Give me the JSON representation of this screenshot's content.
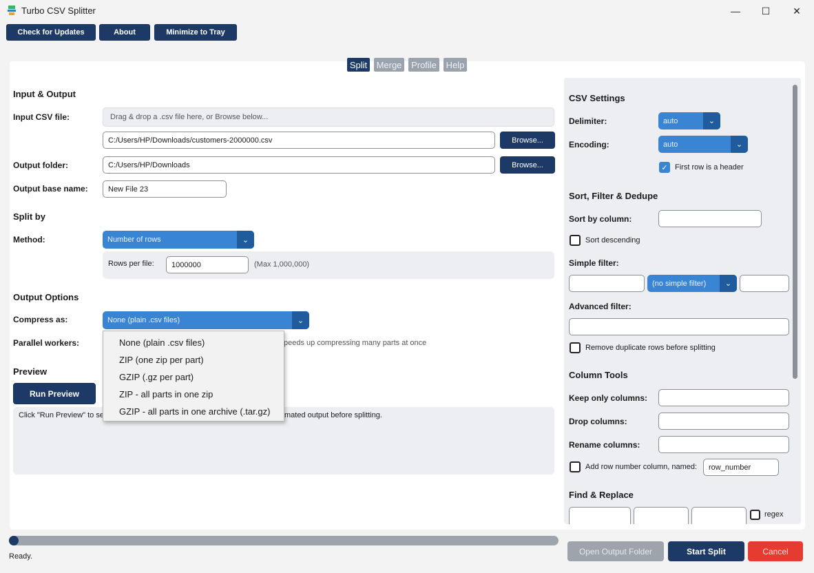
{
  "window": {
    "title": "Turbo CSV Splitter",
    "minimize_glyph": "—",
    "maximize_glyph": "☐",
    "close_glyph": "✕"
  },
  "toolbar": {
    "check_updates": "Check for Updates",
    "about": "About",
    "minimize_tray": "Minimize to Tray"
  },
  "tabs": [
    {
      "label": "Split",
      "active": true
    },
    {
      "label": "Merge",
      "active": false
    },
    {
      "label": "Profile",
      "active": false
    },
    {
      "label": "Help",
      "active": false
    }
  ],
  "input_output": {
    "section": "Input & Output",
    "input_label": "Input CSV file:",
    "dropzone_text": "Drag & drop a .csv file here, or Browse below...",
    "input_path": "C:/Users/HP/Downloads/customers-2000000.csv",
    "browse": "Browse...",
    "output_label": "Output folder:",
    "output_path": "C:/Users/HP/Downloads",
    "basename_label": "Output base name:",
    "basename_value": "New File 23"
  },
  "split_by": {
    "section": "Split by",
    "method_label": "Method:",
    "method_value": "Number of rows",
    "rows_label": "Rows per file:",
    "rows_value": "1000000",
    "rows_hint": "(Max 1,000,000)"
  },
  "output_options": {
    "section": "Output Options",
    "compress_label": "Compress as:",
    "compress_value": "None (plain .csv files)",
    "workers_label": "Parallel workers:",
    "workers_hint": "peeds up compressing many parts at once",
    "compress_options": [
      "None (plain .csv files)",
      "ZIP (one zip per part)",
      "GZIP (.gz per part)",
      "ZIP - all parts in one zip",
      "GZIP - all parts in one archive (.tar.gz)"
    ]
  },
  "preview": {
    "section": "Preview",
    "run_button": "Run Preview",
    "text_left": "Click \"Run Preview\" to se",
    "text_right": "mated output before splitting."
  },
  "csv_settings": {
    "section": "CSV Settings",
    "delimiter_label": "Delimiter:",
    "delimiter_value": "auto",
    "encoding_label": "Encoding:",
    "encoding_value": "auto",
    "header_label": "First row is a header",
    "header_checked": true
  },
  "sort_filter": {
    "section": "Sort, Filter & Dedupe",
    "sort_label": "Sort by column:",
    "sort_desc_label": "Sort descending",
    "simple_filter_label": "Simple filter:",
    "simple_filter_op": "(no simple filter)",
    "advanced_filter_label": "Advanced filter:",
    "dedupe_label": "Remove duplicate rows before splitting"
  },
  "column_tools": {
    "section": "Column Tools",
    "keep_label": "Keep only columns:",
    "drop_label": "Drop columns:",
    "rename_label": "Rename columns:",
    "rownum_label": "Add row number column, named:",
    "rownum_value": "row_number"
  },
  "find_replace": {
    "section": "Find & Replace",
    "regex_label": "regex"
  },
  "status": {
    "text": "Ready.",
    "progress": 0
  },
  "actions": {
    "open_folder": "Open Output Folder",
    "start": "Start Split",
    "cancel": "Cancel"
  },
  "colors": {
    "navy": "#1d3a66",
    "blue": "#3a84d4",
    "red": "#e53b30"
  }
}
